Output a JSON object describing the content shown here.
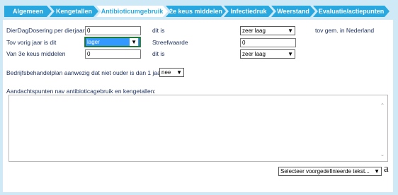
{
  "tabs": [
    {
      "label": "Algemeen",
      "active": false
    },
    {
      "label": "Kengetallen",
      "active": false
    },
    {
      "label": "Antibioticumgebruik",
      "active": true
    },
    {
      "label": "2e keus middelen",
      "active": false
    },
    {
      "label": "Infectiedruk",
      "active": false
    },
    {
      "label": "Weerstand",
      "active": false
    },
    {
      "label": "Evaluatie/actiepunten",
      "active": false
    }
  ],
  "form": {
    "row1": {
      "label": "DierDagDosering per dierjaar",
      "value": "0",
      "ditis": "dit is",
      "rating": "zeer laag",
      "note": "tov gem. in Nederland"
    },
    "row2": {
      "label": "Tov vorig jaar is dit",
      "value": "lager",
      "streef_label": "Streefwaarde",
      "streef_value": "0"
    },
    "row3": {
      "label": "Van 3e keus middelen",
      "value": "0",
      "ditis": "dit is",
      "rating": "zeer laag"
    },
    "plan": {
      "label": "Bedrijfsbehandelplan aanwezig dat niet ouder is dan 1 jaar",
      "value": "nee"
    },
    "aandacht": {
      "label": "Aandachtspunten nav antibioticagebruik en kengetallen:",
      "value": ""
    },
    "predefined": {
      "value": "Selecteer voorgedefinieerde tekst..."
    },
    "spellcheck_glyph": "a"
  },
  "colors": {
    "tab_bg": "#29a8e0",
    "page_bg": "#cfe9f7",
    "text": "#1a2e5a"
  }
}
